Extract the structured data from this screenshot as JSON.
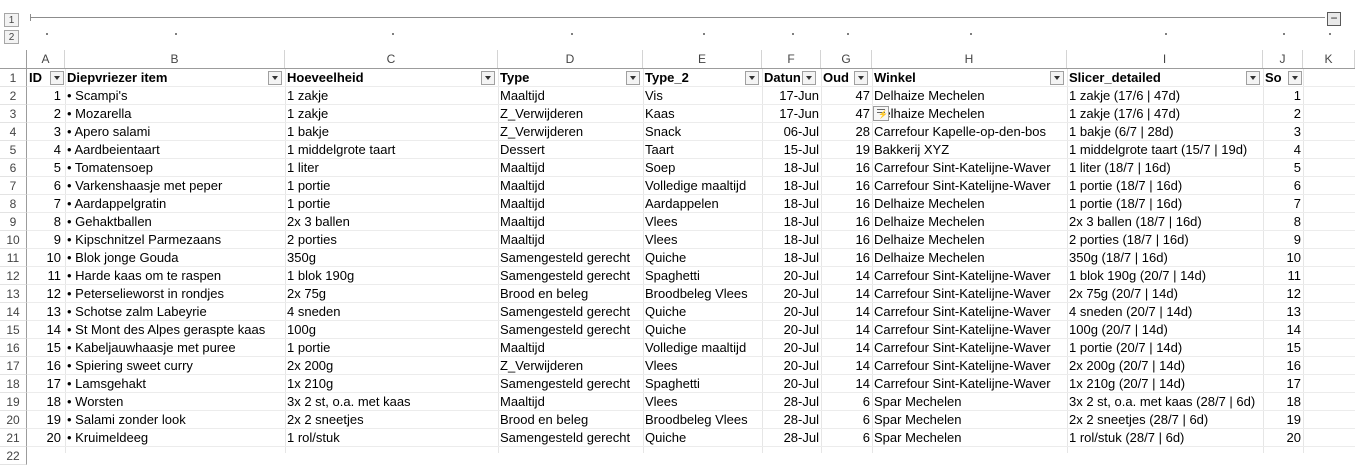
{
  "outline": {
    "levels": [
      "1",
      "2"
    ],
    "collapse_label": "−"
  },
  "columns": [
    "A",
    "B",
    "C",
    "D",
    "E",
    "F",
    "G",
    "H",
    "I",
    "J",
    "K"
  ],
  "headers": [
    "ID",
    "Diepvriezer item",
    "Hoeveelheid",
    "Type",
    "Type_2",
    "Datum",
    "Oud",
    "Winkel",
    "Slicer_detailed",
    "Sort"
  ],
  "header_display": [
    "ID",
    "Diepvriezer item",
    "Hoeveelheid",
    "Type",
    "Type_2",
    "Datun",
    "Oud",
    "Winkel",
    "Slicer_detailed",
    "So"
  ],
  "row_numbers": [
    "1",
    "2",
    "3",
    "4",
    "5",
    "6",
    "7",
    "8",
    "9",
    "10",
    "11",
    "12",
    "13",
    "14",
    "15",
    "16",
    "17",
    "18",
    "19",
    "20",
    "21",
    "22"
  ],
  "rows": [
    [
      "1",
      "• Scampi's",
      "1 zakje",
      "Maaltijd",
      "Vis",
      "17-Jun",
      "47",
      "Delhaize Mechelen",
      "1 zakje (17/6 | 47d)",
      "1"
    ],
    [
      "2",
      "• Mozarella",
      "1 zakje",
      "Z_Verwijderen",
      "Kaas",
      "17-Jun",
      "47",
      "Delhaize Mechelen",
      "1 zakje (17/6 | 47d)",
      "2"
    ],
    [
      "3",
      "• Apero salami",
      "1 bakje",
      "Z_Verwijderen",
      "Snack",
      "06-Jul",
      "28",
      "Carrefour Kapelle-op-den-bos",
      "1 bakje (6/7 | 28d)",
      "3"
    ],
    [
      "4",
      "• Aardbeientaart",
      "1 middelgrote taart",
      "Dessert",
      "Taart",
      "15-Jul",
      "19",
      "Bakkerij XYZ",
      "1 middelgrote taart (15/7 | 19d)",
      "4"
    ],
    [
      "5",
      "• Tomatensoep",
      "1 liter",
      "Maaltijd",
      "Soep",
      "18-Jul",
      "16",
      "Carrefour Sint-Katelijne-Waver",
      "1 liter (18/7 | 16d)",
      "5"
    ],
    [
      "6",
      "• Varkenshaasje met peper",
      "1 portie",
      "Maaltijd",
      "Volledige maaltijd",
      "18-Jul",
      "16",
      "Carrefour Sint-Katelijne-Waver",
      "1 portie (18/7 | 16d)",
      "6"
    ],
    [
      "7",
      "• Aardappelgratin",
      "1 portie",
      "Maaltijd",
      "Aardappelen",
      "18-Jul",
      "16",
      "Delhaize Mechelen",
      "1 portie (18/7 | 16d)",
      "7"
    ],
    [
      "8",
      "• Gehaktballen",
      "2x 3 ballen",
      "Maaltijd",
      "Vlees",
      "18-Jul",
      "16",
      "Delhaize Mechelen",
      "2x 3 ballen (18/7 | 16d)",
      "8"
    ],
    [
      "9",
      "• Kipschnitzel Parmezaans",
      "2 porties",
      "Maaltijd",
      "Vlees",
      "18-Jul",
      "16",
      "Delhaize Mechelen",
      "2 porties (18/7 | 16d)",
      "9"
    ],
    [
      "10",
      "• Blok jonge Gouda",
      "350g",
      "Samengesteld gerecht",
      "Quiche",
      "18-Jul",
      "16",
      "Delhaize Mechelen",
      "350g (18/7 | 16d)",
      "10"
    ],
    [
      "11",
      "• Harde kaas om te raspen",
      "1 blok 190g",
      "Samengesteld gerecht",
      "Spaghetti",
      "20-Jul",
      "14",
      "Carrefour Sint-Katelijne-Waver",
      "1 blok 190g (20/7 | 14d)",
      "11"
    ],
    [
      "12",
      "• Peterselieworst in rondjes",
      "2x 75g",
      "Brood en beleg",
      "Broodbeleg Vlees",
      "20-Jul",
      "14",
      "Carrefour Sint-Katelijne-Waver",
      "2x 75g (20/7 | 14d)",
      "12"
    ],
    [
      "13",
      "• Schotse zalm Labeyrie",
      "4 sneden",
      "Samengesteld gerecht",
      "Quiche",
      "20-Jul",
      "14",
      "Carrefour Sint-Katelijne-Waver",
      "4 sneden (20/7 | 14d)",
      "13"
    ],
    [
      "14",
      "• St Mont des Alpes geraspte kaas",
      "100g",
      "Samengesteld gerecht",
      "Quiche",
      "20-Jul",
      "14",
      "Carrefour Sint-Katelijne-Waver",
      "100g (20/7 | 14d)",
      "14"
    ],
    [
      "15",
      "• Kabeljauwhaasje met puree",
      "1 portie",
      "Maaltijd",
      "Volledige maaltijd",
      "20-Jul",
      "14",
      "Carrefour Sint-Katelijne-Waver",
      "1 portie (20/7 | 14d)",
      "15"
    ],
    [
      "16",
      "• Spiering sweet curry",
      "2x 200g",
      "Z_Verwijderen",
      "Vlees",
      "20-Jul",
      "14",
      "Carrefour Sint-Katelijne-Waver",
      "2x 200g (20/7 | 14d)",
      "16"
    ],
    [
      "17",
      "• Lamsgehakt",
      "1x 210g",
      "Samengesteld gerecht",
      "Spaghetti",
      "20-Jul",
      "14",
      "Carrefour Sint-Katelijne-Waver",
      "1x 210g (20/7 | 14d)",
      "17"
    ],
    [
      "18",
      "• Worsten",
      "3x 2 st, o.a. met kaas",
      "Maaltijd",
      "Vlees",
      "28-Jul",
      "6",
      "Spar Mechelen",
      "3x 2 st, o.a. met kaas (28/7 | 6d)",
      "18"
    ],
    [
      "19",
      "• Salami zonder look",
      "2x 2 sneetjes",
      "Brood en beleg",
      "Broodbeleg Vlees",
      "28-Jul",
      "6",
      "Spar Mechelen",
      "2x 2 sneetjes (28/7 | 6d)",
      "19"
    ],
    [
      "20",
      "• Kruimeldeeg",
      "1 rol/stuk",
      "Samengesteld gerecht",
      "Quiche",
      "28-Jul",
      "6",
      "Spar Mechelen",
      "1 rol/stuk (28/7 | 6d)",
      "20"
    ]
  ]
}
